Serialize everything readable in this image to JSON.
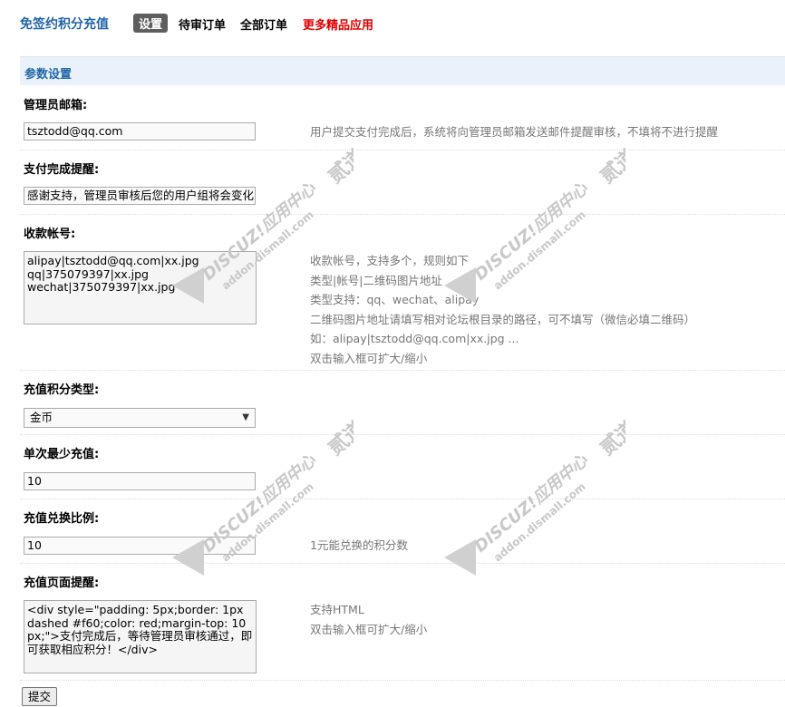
{
  "header": {
    "app_title": "免签约积分充值",
    "tabs": [
      {
        "label": "设置",
        "active": true
      },
      {
        "label": "待审订单",
        "active": false
      },
      {
        "label": "全部订单",
        "active": false
      },
      {
        "label": "更多精品应用",
        "active": false
      }
    ]
  },
  "section": {
    "title": "参数设置"
  },
  "fields": {
    "admin_email": {
      "label": "管理员邮箱:",
      "value": "tsztodd@qq.com",
      "hint": "用户提交支付完成后，系统将向管理员邮箱发送邮件提醒审核，不填将不进行提醒"
    },
    "pay_notice": {
      "label": "支付完成提醒:",
      "value": "感谢支持，管理员审核后您的用户组将会变化<"
    },
    "accounts": {
      "label": "收款帐号:",
      "lines": [
        "alipay|tsztodd@qq.com|xx.jpg",
        "qq|375079397|xx.jpg",
        "wechat|375079397|xx.jpg"
      ],
      "hints": [
        "收款帐号，支持多个，规则如下",
        "类型|帐号|二维码图片地址",
        "类型支持：qq、wechat、alipay",
        "二维码图片地址请填写相对论坛根目录的路径，可不填写（微信必填二维码）",
        "如：alipay|tsztodd@qq.com|xx.jpg ...",
        "双击输入框可扩大/缩小"
      ]
    },
    "credit_type": {
      "label": "充值积分类型:",
      "selected": "金币"
    },
    "min_recharge": {
      "label": "单次最少充值:",
      "value": "10"
    },
    "ratio": {
      "label": "充值兑换比例:",
      "value": "10",
      "hint": "1元能兑换的积分数"
    },
    "page_notice": {
      "label": "充值页面提醒:",
      "value": "<div style=\"padding: 5px;border: 1px dashed #f60;color: red;margin-top: 10px;\">支付完成后，等待管理员审核通过，即可获取相应积分！</div>",
      "hints": [
        "支持HTML",
        "双击输入框可扩大/缩小"
      ]
    }
  },
  "submit_label": "提交",
  "watermark": {
    "brand": "DISCUZ!应用中心",
    "domain": "addon.dismall.com",
    "mark": "贰道",
    "color": "#c8c8c8"
  },
  "colors": {
    "accent": "#2366a8",
    "more_link": "#e00000",
    "section_bg": "#e9f2fa"
  }
}
